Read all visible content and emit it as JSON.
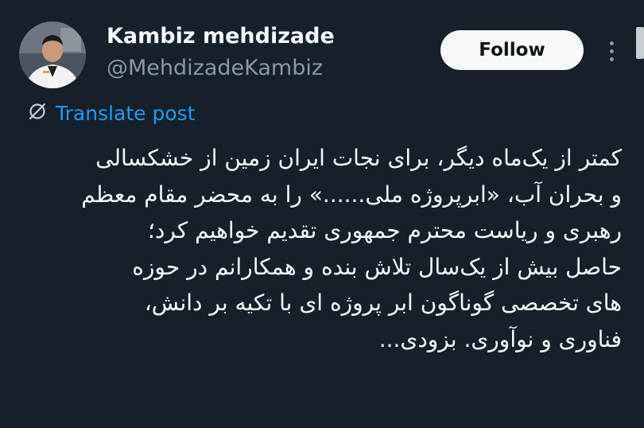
{
  "user": {
    "display_name": "Kambiz mehdizade",
    "handle": "@MehdizadeKambiz"
  },
  "actions": {
    "follow_label": "Follow",
    "more_icon": "more-vertical-icon"
  },
  "translate": {
    "label": "Translate post",
    "icon": "globe-translate-icon"
  },
  "post": {
    "lines": [
      "کمتر از یک‌ماه دیگر، برای نجات ایران زمین از خشکسالی",
      "و بحران آب، «ابرپروژه ملی......» را به محضر مقام معظم",
      "رهبری و ریاست محترم جمهوری تقدیم خواهیم کرد؛",
      "حاصل بیش از یک‌سال تلاش بنده و همکارانم در حوزه",
      "های تخصصی گوناگون  ابر پروژه ای با تکیه بر دانش،",
      "فناوری و نوآوری. بزودی..."
    ]
  },
  "colors": {
    "background": "#15202b",
    "text": "#f7f9f9",
    "secondary": "#8b98a5",
    "link": "#1d9bf0",
    "button_bg": "#f7f9f9",
    "button_text": "#0f1419"
  }
}
